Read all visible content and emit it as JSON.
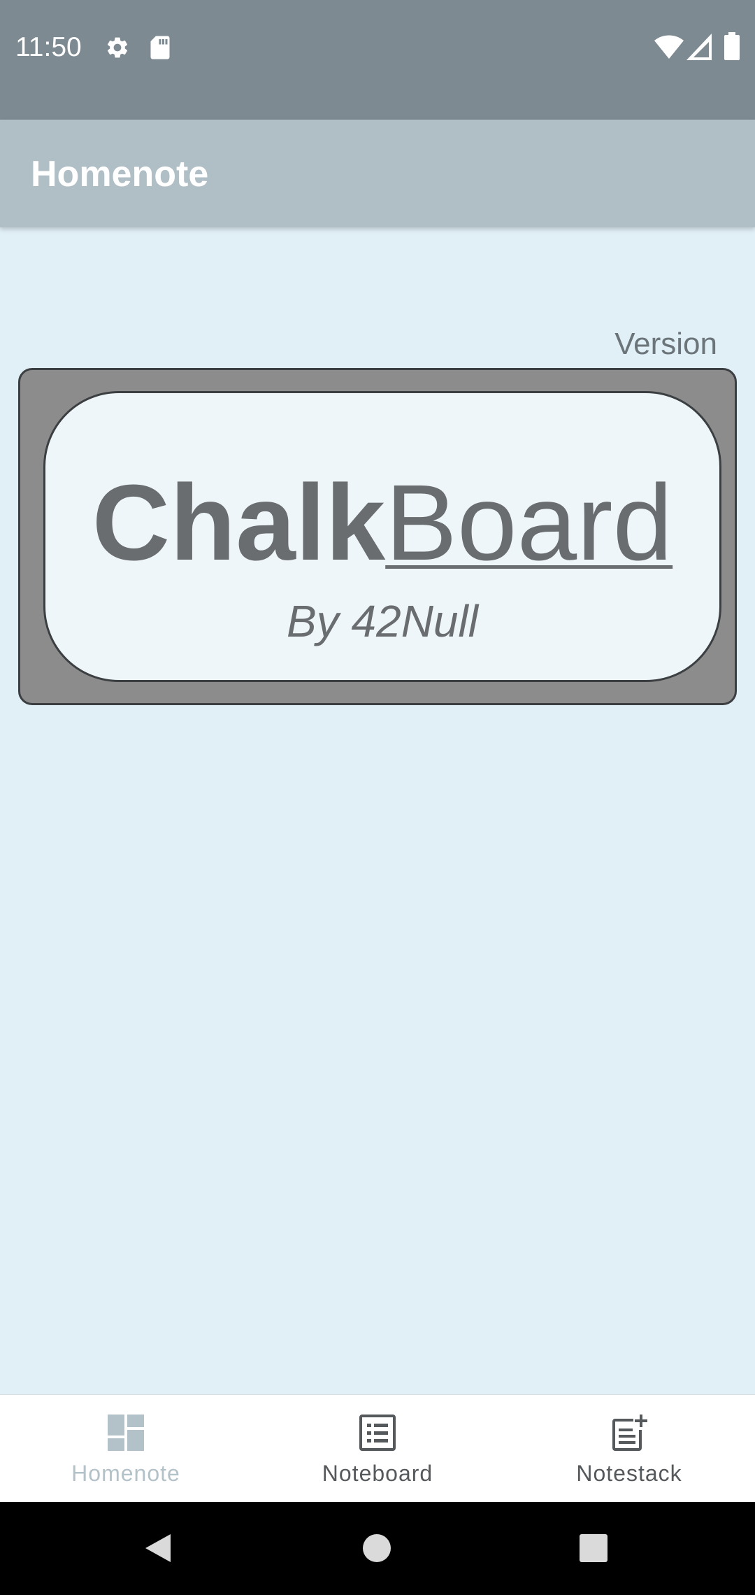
{
  "status_bar": {
    "time": "11:50",
    "icons": [
      "gear-icon",
      "sd-card-icon",
      "wifi-icon",
      "cell-signal-icon",
      "battery-icon"
    ]
  },
  "app_bar": {
    "title": "Homenote"
  },
  "content": {
    "version_label": "Version",
    "logo": {
      "title_bold": "Chalk",
      "title_underlined": "Board",
      "byline": "By 42Null"
    }
  },
  "bottom_nav": {
    "items": [
      {
        "label": "Homenote",
        "icon": "dashboard-icon",
        "active": true
      },
      {
        "label": "Noteboard",
        "icon": "list-icon",
        "active": false
      },
      {
        "label": "Notestack",
        "icon": "note-add-icon",
        "active": false
      }
    ]
  },
  "system_nav": {
    "icons": [
      "back-icon",
      "home-icon",
      "recents-icon"
    ]
  },
  "colors": {
    "status_bar": "#7D8A91",
    "app_bar": "#B0BEC5",
    "background": "#E1EFF6",
    "logo_frame": "#8C8C8C",
    "logo_panel": "#EEF6F9",
    "nav_active": "#B3C1C8",
    "nav_inactive": "#55595C"
  }
}
